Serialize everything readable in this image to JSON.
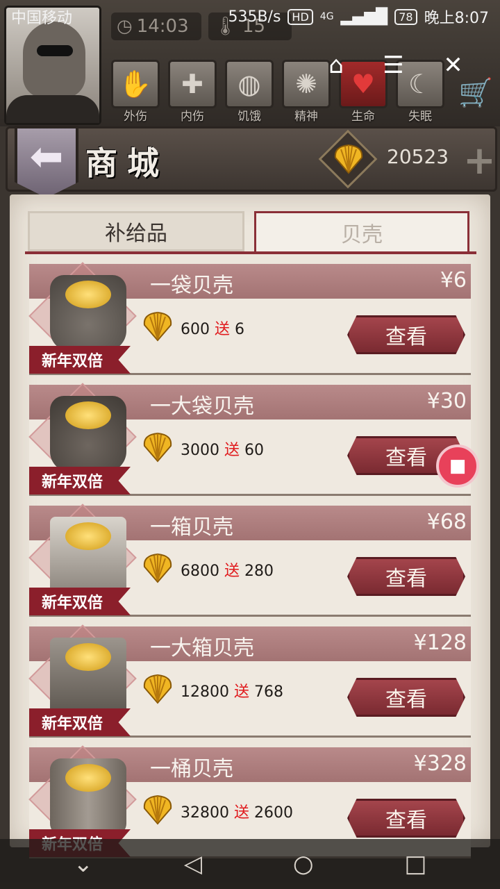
{
  "status_bar": {
    "carrier": "中国移动",
    "speed": "535B/s",
    "network": "4G",
    "battery": "78",
    "time": "晚上8:07"
  },
  "hud": {
    "clock": "14:03",
    "temperature": "15",
    "stats": [
      {
        "label": "外伤",
        "icon": "hand-icon"
      },
      {
        "label": "内伤",
        "icon": "cross-icon"
      },
      {
        "label": "饥饿",
        "icon": "stomach-icon"
      },
      {
        "label": "精神",
        "icon": "brain-icon"
      },
      {
        "label": "生命",
        "icon": "heart-icon"
      },
      {
        "label": "失眠",
        "icon": "moon-icon"
      }
    ]
  },
  "title": "商城",
  "currency": {
    "amount": "20523"
  },
  "tabs": [
    {
      "label": "补给品",
      "active": false
    },
    {
      "label": "贝壳",
      "active": true
    }
  ],
  "items": [
    {
      "name": "一袋贝壳",
      "price": "¥6",
      "base": "600",
      "bonus_label": "送",
      "bonus": "6",
      "badge": "新年双倍",
      "button": "查看"
    },
    {
      "name": "一大袋贝壳",
      "price": "¥30",
      "base": "3000",
      "bonus_label": "送",
      "bonus": "60",
      "badge": "新年双倍",
      "button": "查看"
    },
    {
      "name": "一箱贝壳",
      "price": "¥68",
      "base": "6800",
      "bonus_label": "送",
      "bonus": "280",
      "badge": "新年双倍",
      "button": "查看"
    },
    {
      "name": "一大箱贝壳",
      "price": "¥128",
      "base": "12800",
      "bonus_label": "送",
      "bonus": "768",
      "badge": "新年双倍",
      "button": "查看"
    },
    {
      "name": "一桶贝壳",
      "price": "¥328",
      "base": "32800",
      "bonus_label": "送",
      "bonus": "2600",
      "badge": "新年双倍",
      "button": "查看"
    }
  ],
  "colors": {
    "accent": "#8a2f37",
    "bonus": "#e0191c",
    "parchment": "#ece6dc"
  }
}
